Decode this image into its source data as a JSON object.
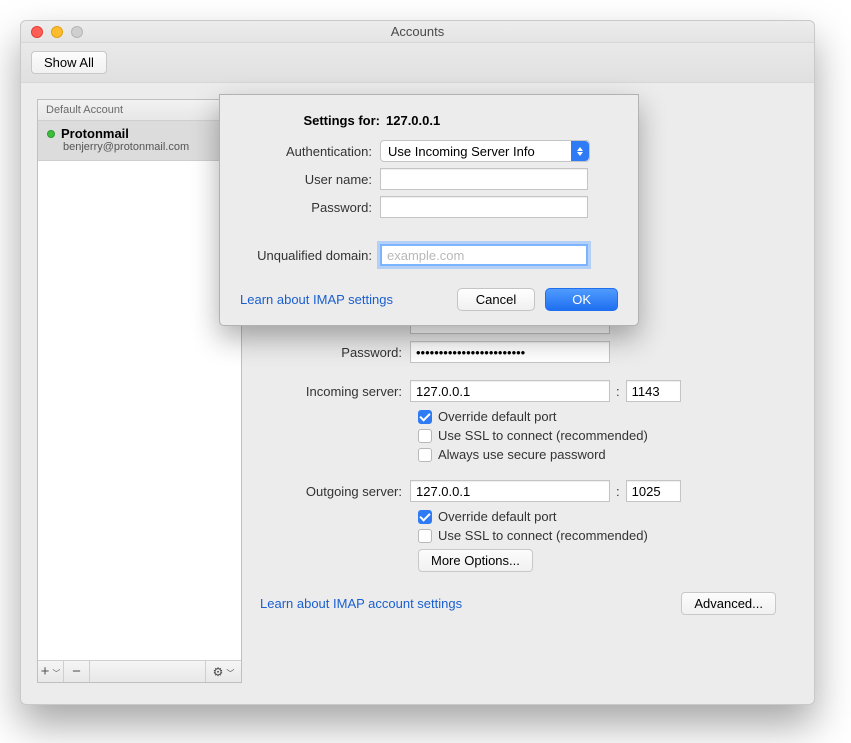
{
  "window": {
    "title": "Accounts",
    "show_all": "Show All"
  },
  "sidebar": {
    "header": "Default Account",
    "items": [
      {
        "name": "Protonmail",
        "address": "benjerry@protonmail.com",
        "status": "online"
      }
    ],
    "add": "+",
    "remove": "−"
  },
  "main": {
    "password_label": "Password:",
    "password_value": "••••••••••••••••••••••••",
    "incoming_label": "Incoming server:",
    "incoming_value": "127.0.0.1",
    "incoming_port": "1143",
    "outgoing_label": "Outgoing server:",
    "outgoing_value": "127.0.0.1",
    "outgoing_port": "1025",
    "override_port": "Override default port",
    "use_ssl": "Use SSL to connect (recommended)",
    "always_secure": "Always use secure password",
    "more_options": "More Options...",
    "learn_link": "Learn about IMAP account settings",
    "advanced": "Advanced..."
  },
  "sheet": {
    "title_label": "Settings for:",
    "title_value": "127.0.0.1",
    "auth_label": "Authentication:",
    "auth_value": "Use Incoming Server Info",
    "user_label": "User name:",
    "user_value": "",
    "pass_label": "Password:",
    "pass_value": "",
    "domain_label": "Unqualified domain:",
    "domain_placeholder": "example.com",
    "domain_value": "",
    "learn_link": "Learn about IMAP settings",
    "cancel": "Cancel",
    "ok": "OK"
  },
  "checks": {
    "incoming_override": true,
    "incoming_ssl": false,
    "incoming_secure": false,
    "outgoing_override": true,
    "outgoing_ssl": false
  }
}
